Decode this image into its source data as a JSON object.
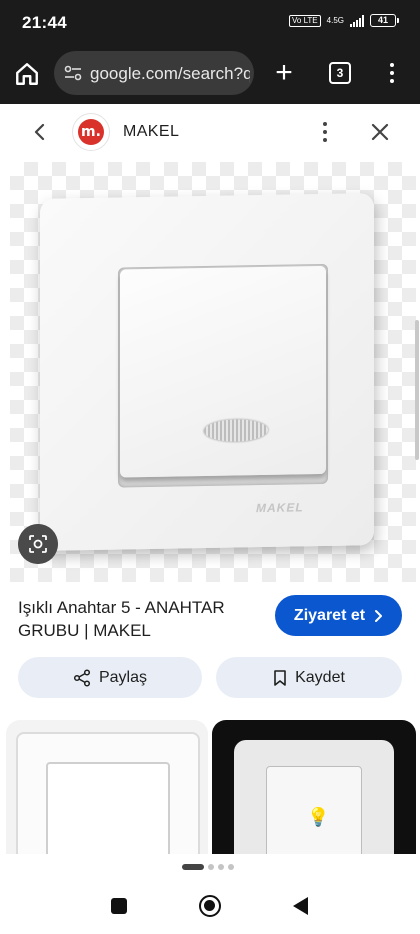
{
  "status_bar": {
    "time": "21:44",
    "volte": "Vo LTE",
    "network": "4.5G",
    "battery": "41"
  },
  "browser": {
    "url": "google.com/search?q",
    "tab_count": "3",
    "home_icon": "home-icon",
    "tune_icon": "tune-icon",
    "new_tab_icon": "plus-icon",
    "menu_icon": "more-vert-icon"
  },
  "viewer": {
    "site_name": "MAKEL",
    "site_logo_letter": "m.",
    "back_icon": "chevron-left-icon",
    "more_icon": "more-vert-icon",
    "close_icon": "close-icon"
  },
  "image": {
    "brand_text": "MAKEL",
    "lens_icon": "google-lens-icon"
  },
  "result": {
    "title": "Işıklı Anahtar 5 - ANAHTAR GRUBU | MAKEL",
    "visit_label": "Ziyaret et",
    "share_label": "Paylaş",
    "save_label": "Kaydet"
  },
  "colors": {
    "accent": "#0b57d0",
    "chip_bg": "#e9eef6",
    "brand_red": "#d8322a",
    "bar_bg": "#1b1b1b"
  }
}
